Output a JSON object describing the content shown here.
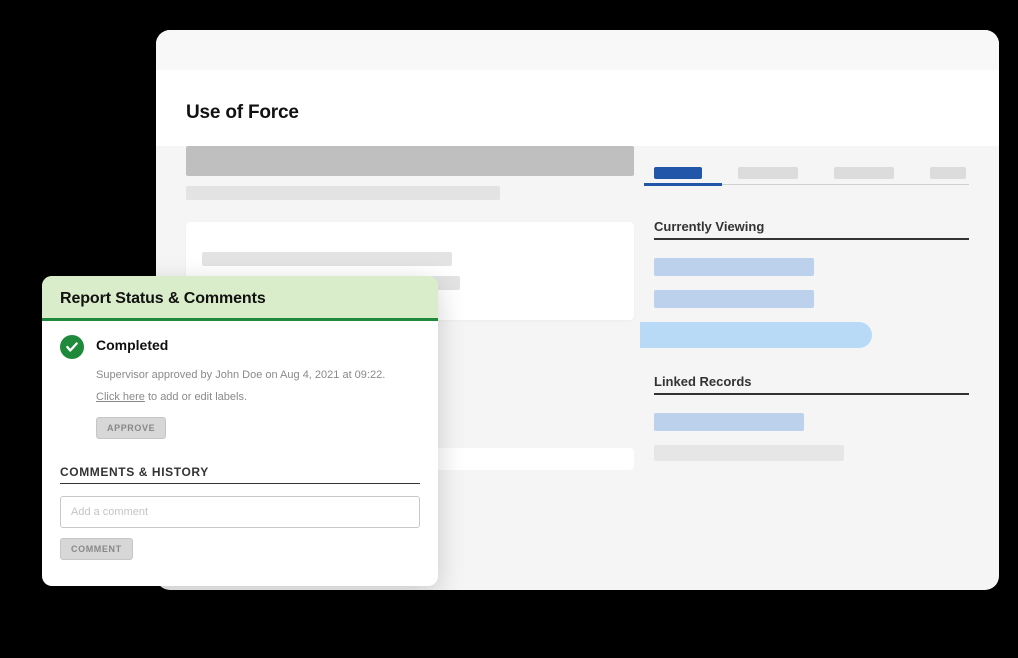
{
  "page_title": "Use of Force",
  "right_panel": {
    "currently_viewing_heading": "Currently Viewing",
    "linked_records_heading": "Linked Records"
  },
  "modal": {
    "title": "Report Status & Comments",
    "status_label": "Completed",
    "approved_line": "Supervisor approved by John Doe on Aug 4, 2021 at 09:22.",
    "edit_labels_link": "Click here",
    "edit_labels_rest": " to add or edit labels.",
    "approve_button": "APPROVE",
    "comments_heading": "COMMENTS & HISTORY",
    "comment_placeholder": "Add a comment",
    "comment_button": "COMMENT"
  }
}
